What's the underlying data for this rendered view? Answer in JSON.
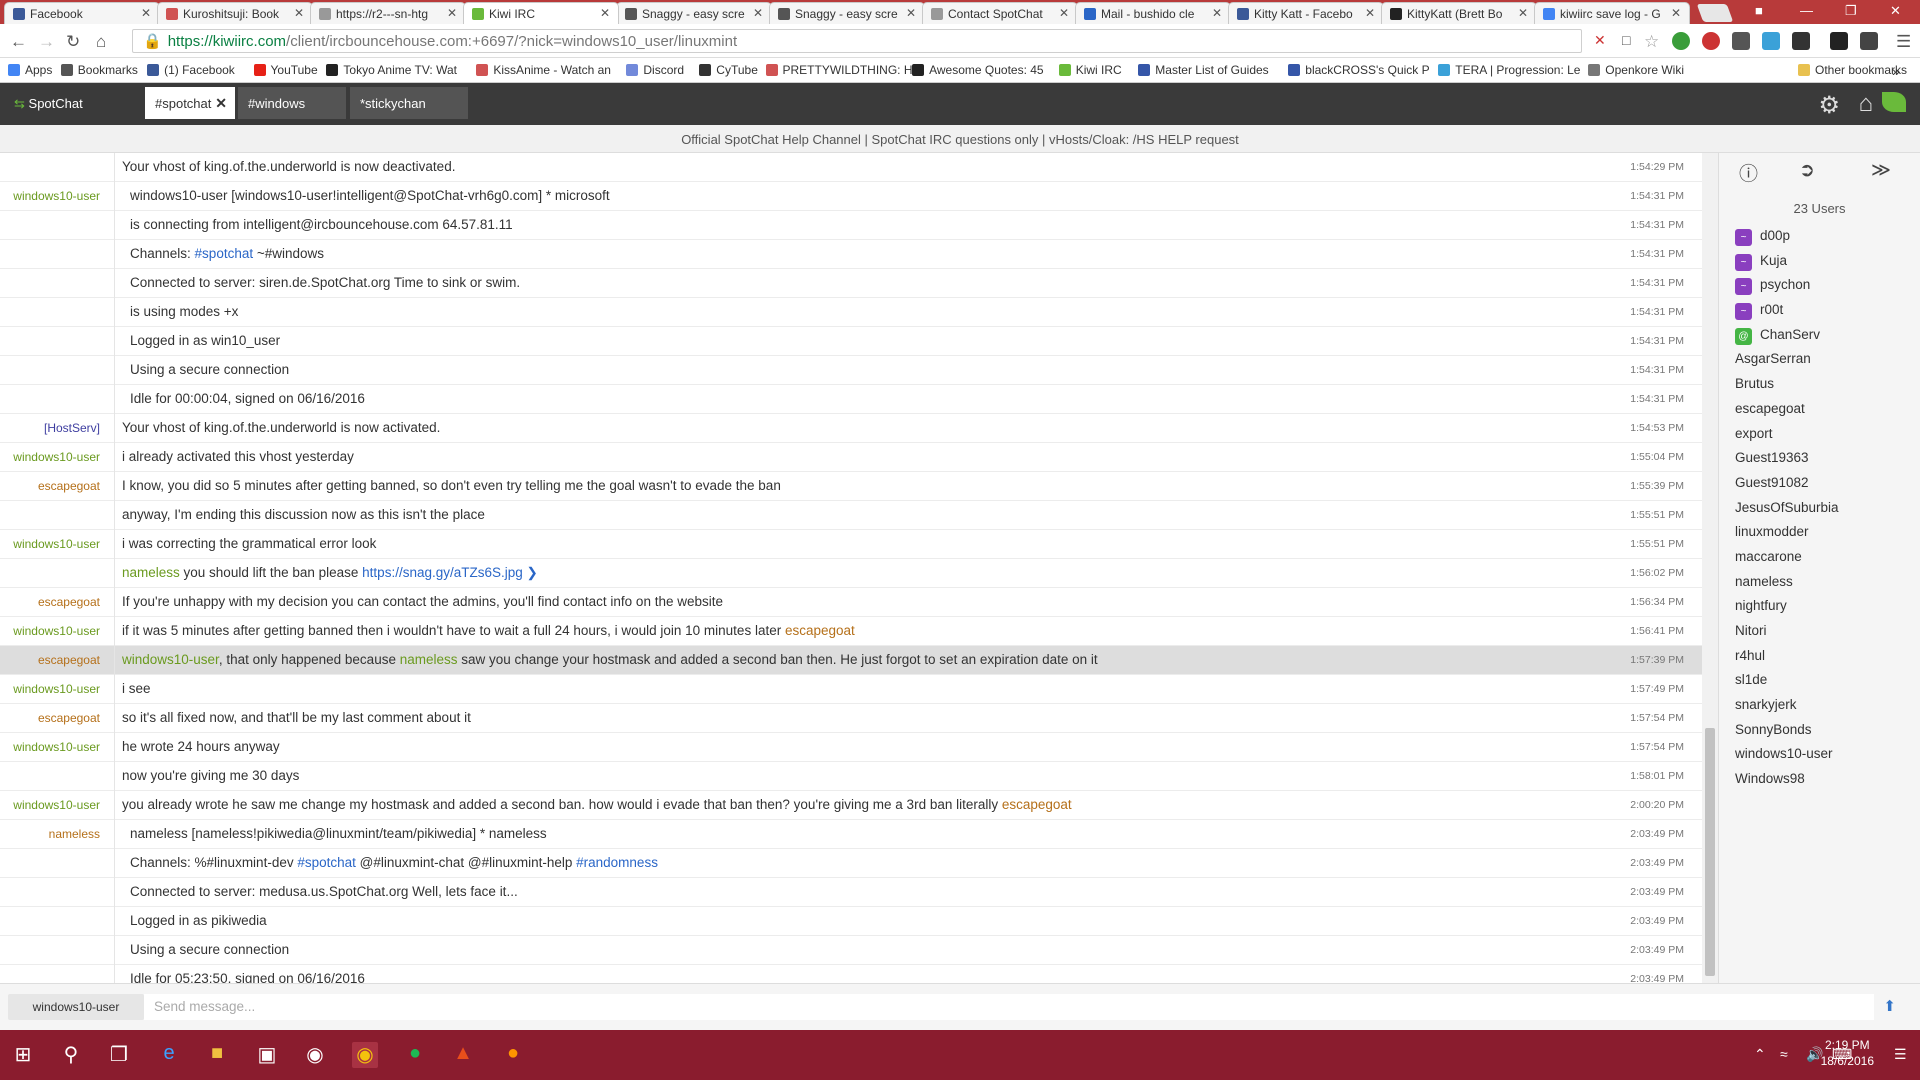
{
  "browser": {
    "tabs": [
      {
        "label": "Facebook",
        "color": "#3b5998"
      },
      {
        "label": "Kuroshitsuji: Book",
        "color": "#d05353"
      },
      {
        "label": "https://r2---sn-htg",
        "color": "#999999"
      },
      {
        "label": "Kiwi IRC",
        "color": "#6aba3b"
      },
      {
        "label": "Snaggy - easy scre",
        "color": "#555555"
      },
      {
        "label": "Snaggy - easy scre",
        "color": "#555555"
      },
      {
        "label": "Contact SpotChat",
        "color": "#999999"
      },
      {
        "label": "Mail - bushido cle",
        "color": "#2a66c7"
      },
      {
        "label": "Kitty Katt - Facebo",
        "color": "#3b5998"
      },
      {
        "label": "KittyKatt (Brett Bo",
        "color": "#222222"
      },
      {
        "label": "kiwiirc save log - G",
        "color": "#4285f4"
      }
    ],
    "active_tab": 3,
    "url_host": "https://kiwiirc.com",
    "url_path": "/client/ircbouncehouse.com:+6697/?nick=windows10_user/linuxmint",
    "bookmarks": [
      "Apps",
      "Bookmarks",
      "(1) Facebook",
      "YouTube",
      "Tokyo Anime TV: Wat",
      "KissAnime - Watch an",
      "Discord",
      "CyTube",
      "PRETTYWILDTHING: H",
      "Awesome Quotes: 45",
      "Kiwi IRC",
      "Master List of Guides",
      "blackCROSS's Quick P",
      "TERA | Progression: Le",
      "Openkore Wiki"
    ],
    "other_bookmarks": "Other bookmarks"
  },
  "kiwi": {
    "network": "SpotChat",
    "tabs": [
      {
        "label": "#spotchat",
        "active": true
      },
      {
        "label": "#windows",
        "active": false
      },
      {
        "label": "*stickychan",
        "active": false
      }
    ],
    "topic": "Official SpotChat Help Channel | SpotChat IRC questions only | vHosts/Cloak: /HS HELP request",
    "user_count": "23 Users",
    "input_nick": "windows10-user",
    "input_placeholder": "Send message..."
  },
  "messages": [
    {
      "nick": "",
      "msg": "Your vhost of king.of.the.underworld is now deactivated.",
      "time": "1:54:29 PM",
      "ind": false
    },
    {
      "nick": "windows10-user",
      "msg": "windows10-user [windows10-user!intelligent@SpotChat-vrh6g0.com] * microsoft",
      "time": "1:54:31 PM",
      "ind": true
    },
    {
      "nick": "",
      "msg": "is connecting from intelligent@ircbouncehouse.com 64.57.81.11",
      "time": "1:54:31 PM",
      "ind": true
    },
    {
      "nick": "",
      "msg": "Channels: #spotchat ~#windows",
      "time": "1:54:31 PM",
      "ind": true
    },
    {
      "nick": "",
      "msg": "Connected to server: siren.de.SpotChat.org Time to sink or swim.",
      "time": "1:54:31 PM",
      "ind": true
    },
    {
      "nick": "",
      "msg": "is using modes +x",
      "time": "1:54:31 PM",
      "ind": true
    },
    {
      "nick": "",
      "msg": "Logged in as win10_user",
      "time": "1:54:31 PM",
      "ind": true
    },
    {
      "nick": "",
      "msg": "Using a secure connection",
      "time": "1:54:31 PM",
      "ind": true
    },
    {
      "nick": "",
      "msg": "Idle for 00:00:04, signed on 06/16/2016",
      "time": "1:54:31 PM",
      "ind": true
    },
    {
      "nick": "[HostServ]",
      "msg": "Your vhost of king.of.the.underworld is now activated.",
      "time": "1:54:53 PM",
      "ind": false
    },
    {
      "nick": "windows10-user",
      "msg": "i already activated this vhost yesterday",
      "time": "1:55:04 PM",
      "ind": false
    },
    {
      "nick": "escapegoat",
      "msg": "I know, you did so 5 minutes after getting banned, so don't even try telling me the goal wasn't to evade the ban",
      "time": "1:55:39 PM",
      "ind": false
    },
    {
      "nick": "",
      "msg": "anyway, I'm ending this discussion now as this isn't the place",
      "time": "1:55:51 PM",
      "ind": false
    },
    {
      "nick": "windows10-user",
      "msg": "i was correcting the grammatical error look",
      "time": "1:55:51 PM",
      "ind": false
    },
    {
      "nick": "",
      "msg": "nameless you should lift the ban please https://snag.gy/aTZs6S.jpg",
      "time": "1:56:02 PM",
      "ind": false
    },
    {
      "nick": "escapegoat",
      "msg": "If you're unhappy with my decision you can contact the admins, you'll find contact info on the website",
      "time": "1:56:34 PM",
      "ind": false
    },
    {
      "nick": "windows10-user",
      "msg": "if it was 5 minutes after getting banned then i wouldn't have to wait a full 24 hours, i would join 10 minutes later escapegoat",
      "time": "1:56:41 PM",
      "ind": false
    },
    {
      "nick": "escapegoat",
      "msg": "windows10-user, that only happened because nameless saw you change your hostmask and added a second ban then. He just forgot to set an expiration date on it",
      "time": "1:57:39 PM",
      "ind": false,
      "hl": true
    },
    {
      "nick": "windows10-user",
      "msg": "i see",
      "time": "1:57:49 PM",
      "ind": false
    },
    {
      "nick": "escapegoat",
      "msg": "so it's all fixed now, and that'll be my last comment about it",
      "time": "1:57:54 PM",
      "ind": false
    },
    {
      "nick": "windows10-user",
      "msg": "he wrote 24 hours anyway",
      "time": "1:57:54 PM",
      "ind": false
    },
    {
      "nick": "",
      "msg": "now you're giving me 30 days",
      "time": "1:58:01 PM",
      "ind": false
    },
    {
      "nick": "windows10-user",
      "msg": "you already wrote he saw me change my hostmask and added a second ban. how would i evade that ban then? you're giving me a 3rd ban literally escapegoat",
      "time": "2:00:20 PM",
      "ind": false
    },
    {
      "nick": "nameless",
      "msg": "nameless [nameless!pikiwedia@linuxmint/team/pikiwedia] * nameless",
      "time": "2:03:49 PM",
      "ind": true
    },
    {
      "nick": "",
      "msg": "Channels: %#linuxmint-dev #spotchat @#linuxmint-chat @#linuxmint-help #randomness",
      "time": "2:03:49 PM",
      "ind": true
    },
    {
      "nick": "",
      "msg": "Connected to server: medusa.us.SpotChat.org Well, lets face it...",
      "time": "2:03:49 PM",
      "ind": true
    },
    {
      "nick": "",
      "msg": "Logged in as pikiwedia",
      "time": "2:03:49 PM",
      "ind": true
    },
    {
      "nick": "",
      "msg": "Using a secure connection",
      "time": "2:03:49 PM",
      "ind": true
    },
    {
      "nick": "",
      "msg": "Idle for 05:23:50, signed on 06/16/2016",
      "time": "2:03:49 PM",
      "ind": true
    }
  ],
  "users": [
    {
      "name": "d00p",
      "badge": "~",
      "kind": "p"
    },
    {
      "name": "Kuja",
      "badge": "~",
      "kind": "p"
    },
    {
      "name": "psychon",
      "badge": "~",
      "kind": "p"
    },
    {
      "name": "r00t",
      "badge": "~",
      "kind": "p"
    },
    {
      "name": "ChanServ",
      "badge": "@",
      "kind": "g"
    },
    {
      "name": "AsgarSerran"
    },
    {
      "name": "Brutus"
    },
    {
      "name": "escapegoat"
    },
    {
      "name": "export"
    },
    {
      "name": "Guest19363"
    },
    {
      "name": "Guest91082"
    },
    {
      "name": "JesusOfSuburbia"
    },
    {
      "name": "linuxmodder"
    },
    {
      "name": "maccarone"
    },
    {
      "name": "nameless"
    },
    {
      "name": "nightfury"
    },
    {
      "name": "Nitori"
    },
    {
      "name": "r4hul"
    },
    {
      "name": "sl1de"
    },
    {
      "name": "snarkyjerk"
    },
    {
      "name": "SonnyBonds"
    },
    {
      "name": "windows10-user"
    },
    {
      "name": "Windows98"
    }
  ],
  "clock": {
    "time": "2:19 PM",
    "date": "18/6/2016"
  },
  "colors": {
    "accent": "#6aba3b",
    "taskbar": "#8a1c2e",
    "tabstrip": "#b83a3a"
  }
}
